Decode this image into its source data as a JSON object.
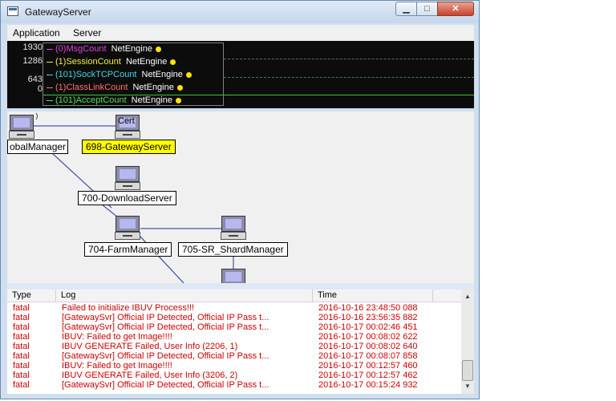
{
  "window": {
    "title": "GatewayServer",
    "minimize": "▁",
    "maximize": "□",
    "close": "✕"
  },
  "menu": [
    {
      "label": "Application"
    },
    {
      "label": "Server"
    }
  ],
  "monitor": {
    "y_labels": [
      "1930",
      "1286",
      "643",
      "0"
    ],
    "legend": [
      {
        "label": "(0)MsgCount",
        "source": "NetEngine",
        "color": "#e040e0"
      },
      {
        "label": "(1)SessionCount",
        "source": "NetEngine",
        "color": "#f0f040"
      },
      {
        "label": "(101)SockTCPCount",
        "source": "NetEngine",
        "color": "#40d8e8"
      },
      {
        "label": "(1)ClassLinkCount",
        "source": "NetEngine",
        "color": "#ff7070"
      },
      {
        "label": "(101)AcceptCount",
        "source": "NetEngine",
        "color": "#50e050"
      }
    ]
  },
  "topology": {
    "nodes": [
      {
        "name": "obalManager",
        "selected": false
      },
      {
        "name": "698-GatewayServer",
        "selected": true,
        "icon_text": "Cert"
      },
      {
        "name": "700-DownloadServer",
        "selected": false
      },
      {
        "name": "704-FarmManager",
        "selected": false
      },
      {
        "name": "705-SR_ShardManager",
        "selected": false
      }
    ]
  },
  "log": {
    "columns": {
      "type": "Type",
      "log": "Log",
      "time": "Time"
    },
    "rows": [
      {
        "type": "fatal",
        "log": "Failed to initialize IBUV Process!!!",
        "time": "2016-10-16 23:48:50 088"
      },
      {
        "type": "fatal",
        "log": "[GatewaySvr] Official IP Detected, Official IP Pass t...",
        "time": "2016-10-16 23:56:35 882"
      },
      {
        "type": "fatal",
        "log": "[GatewaySvr] Official IP Detected, Official IP Pass t...",
        "time": "2016-10-17 00:02:46 451"
      },
      {
        "type": "fatal",
        "log": "IBUV: Failed to get Image!!!!",
        "time": "2016-10-17 00:08:02 622"
      },
      {
        "type": "fatal",
        "log": "IBUV GENERATE Failed, User Info (2206, 1)",
        "time": "2016-10-17 00:08:02 640"
      },
      {
        "type": "fatal",
        "log": "[GatewaySvr] Official IP Detected, Official IP Pass t...",
        "time": "2016-10-17 00:08:07 858"
      },
      {
        "type": "fatal",
        "log": "IBUV: Failed to get Image!!!!",
        "time": "2016-10-17 00:12:57 460"
      },
      {
        "type": "fatal",
        "log": "IBUV GENERATE Failed, User Info (3206, 2)",
        "time": "2016-10-17 00:12:57 462"
      },
      {
        "type": "fatal",
        "log": "[GatewaySvr] Official IP Detected, Official IP Pass t...",
        "time": "2016-10-17 00:15:24 932"
      }
    ]
  },
  "scrollbar": {
    "up": "▲",
    "down": "▼"
  }
}
